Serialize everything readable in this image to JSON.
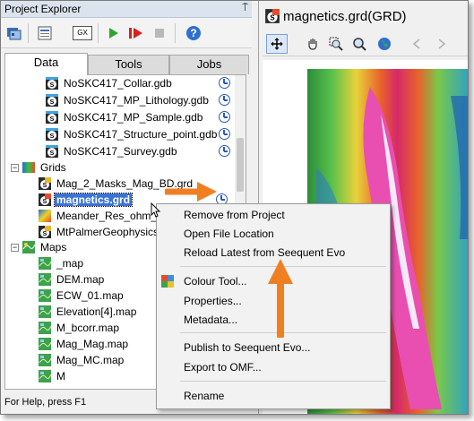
{
  "panel": {
    "title": "Project Explorer",
    "pin_glyph": "⍑"
  },
  "toolbar": {
    "icons": [
      "open-project-icon",
      "project-list-icon",
      "gx-icon",
      "run-icon",
      "record-icon",
      "stop-icon",
      "help-icon"
    ],
    "gx_label": "GX"
  },
  "tabs": [
    "Data",
    "Tools",
    "Jobs"
  ],
  "tree": {
    "databases": [
      "NoSKC417_Collar.gdb",
      "NoSKC417_MP_Lithology.gdb",
      "NoSKC417_MP_Sample.gdb",
      "NoSKC417_Structure_point.gdb",
      "NoSKC417_Survey.gdb"
    ],
    "grids_label": "Grids",
    "grids": [
      "Mag_2_Masks_Mag_BD.grd",
      "magnetics.grd",
      "Meander_Res_ohm_",
      "MtPalmerGeophysics"
    ],
    "maps_label": "Maps",
    "maps": [
      "_map",
      "DEM.map",
      "ECW_01.map",
      "Elevation[4].map",
      "M_bcorr.map",
      "Mag_Mag.map",
      "Mag_MC.map",
      "M"
    ]
  },
  "status": {
    "text": "For Help, press F1"
  },
  "document": {
    "title": "magnetics.grd(GRD)",
    "toolbar_icons": [
      "select-icon",
      "pan-icon",
      "zoom-box-icon",
      "zoom-icon",
      "globe-icon",
      "back-icon",
      "forward-icon"
    ]
  },
  "context_menu": {
    "items": [
      "Remove from Project",
      "Open File Location",
      "Reload Latest from Seequent Evo",
      "Colour Tool...",
      "Properties...",
      "Metadata...",
      "Publish to Seequent Evo...",
      "Export to OMF...",
      "Rename"
    ]
  },
  "colors": {
    "accent_arrow": "#f07f22",
    "selection": "#3b73d6",
    "title_bar": "#dbe3ee"
  }
}
